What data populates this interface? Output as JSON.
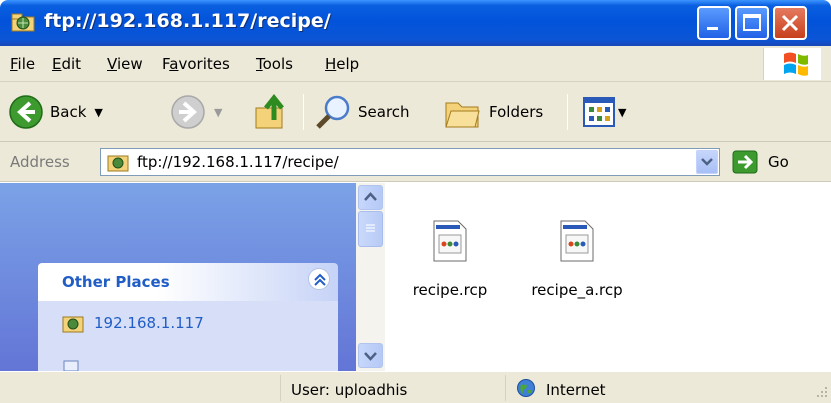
{
  "window": {
    "title": "ftp://192.168.1.117/recipe/"
  },
  "menu": {
    "items": [
      {
        "label": "File",
        "key": "F"
      },
      {
        "label": "Edit",
        "key": "E"
      },
      {
        "label": "View",
        "key": "V"
      },
      {
        "label": "Favorites",
        "key": "a"
      },
      {
        "label": "Tools",
        "key": "T"
      },
      {
        "label": "Help",
        "key": "H"
      }
    ]
  },
  "toolbar": {
    "back_label": "Back",
    "search_label": "Search",
    "folders_label": "Folders"
  },
  "address": {
    "label": "Address",
    "value": "ftp://192.168.1.117/recipe/",
    "go_label": "Go"
  },
  "sidebar": {
    "other_places_title": "Other Places",
    "places": [
      {
        "label": "192.168.1.117"
      }
    ]
  },
  "files": [
    {
      "name": "recipe.rcp"
    },
    {
      "name": "recipe_a.rcp"
    }
  ],
  "status": {
    "user_text": "User: uploadhis",
    "zone_text": "Internet"
  },
  "colors": {
    "title_bar": "#0253da",
    "sidebar_gradient_top": "#7ba2e7",
    "link": "#215dc6"
  }
}
